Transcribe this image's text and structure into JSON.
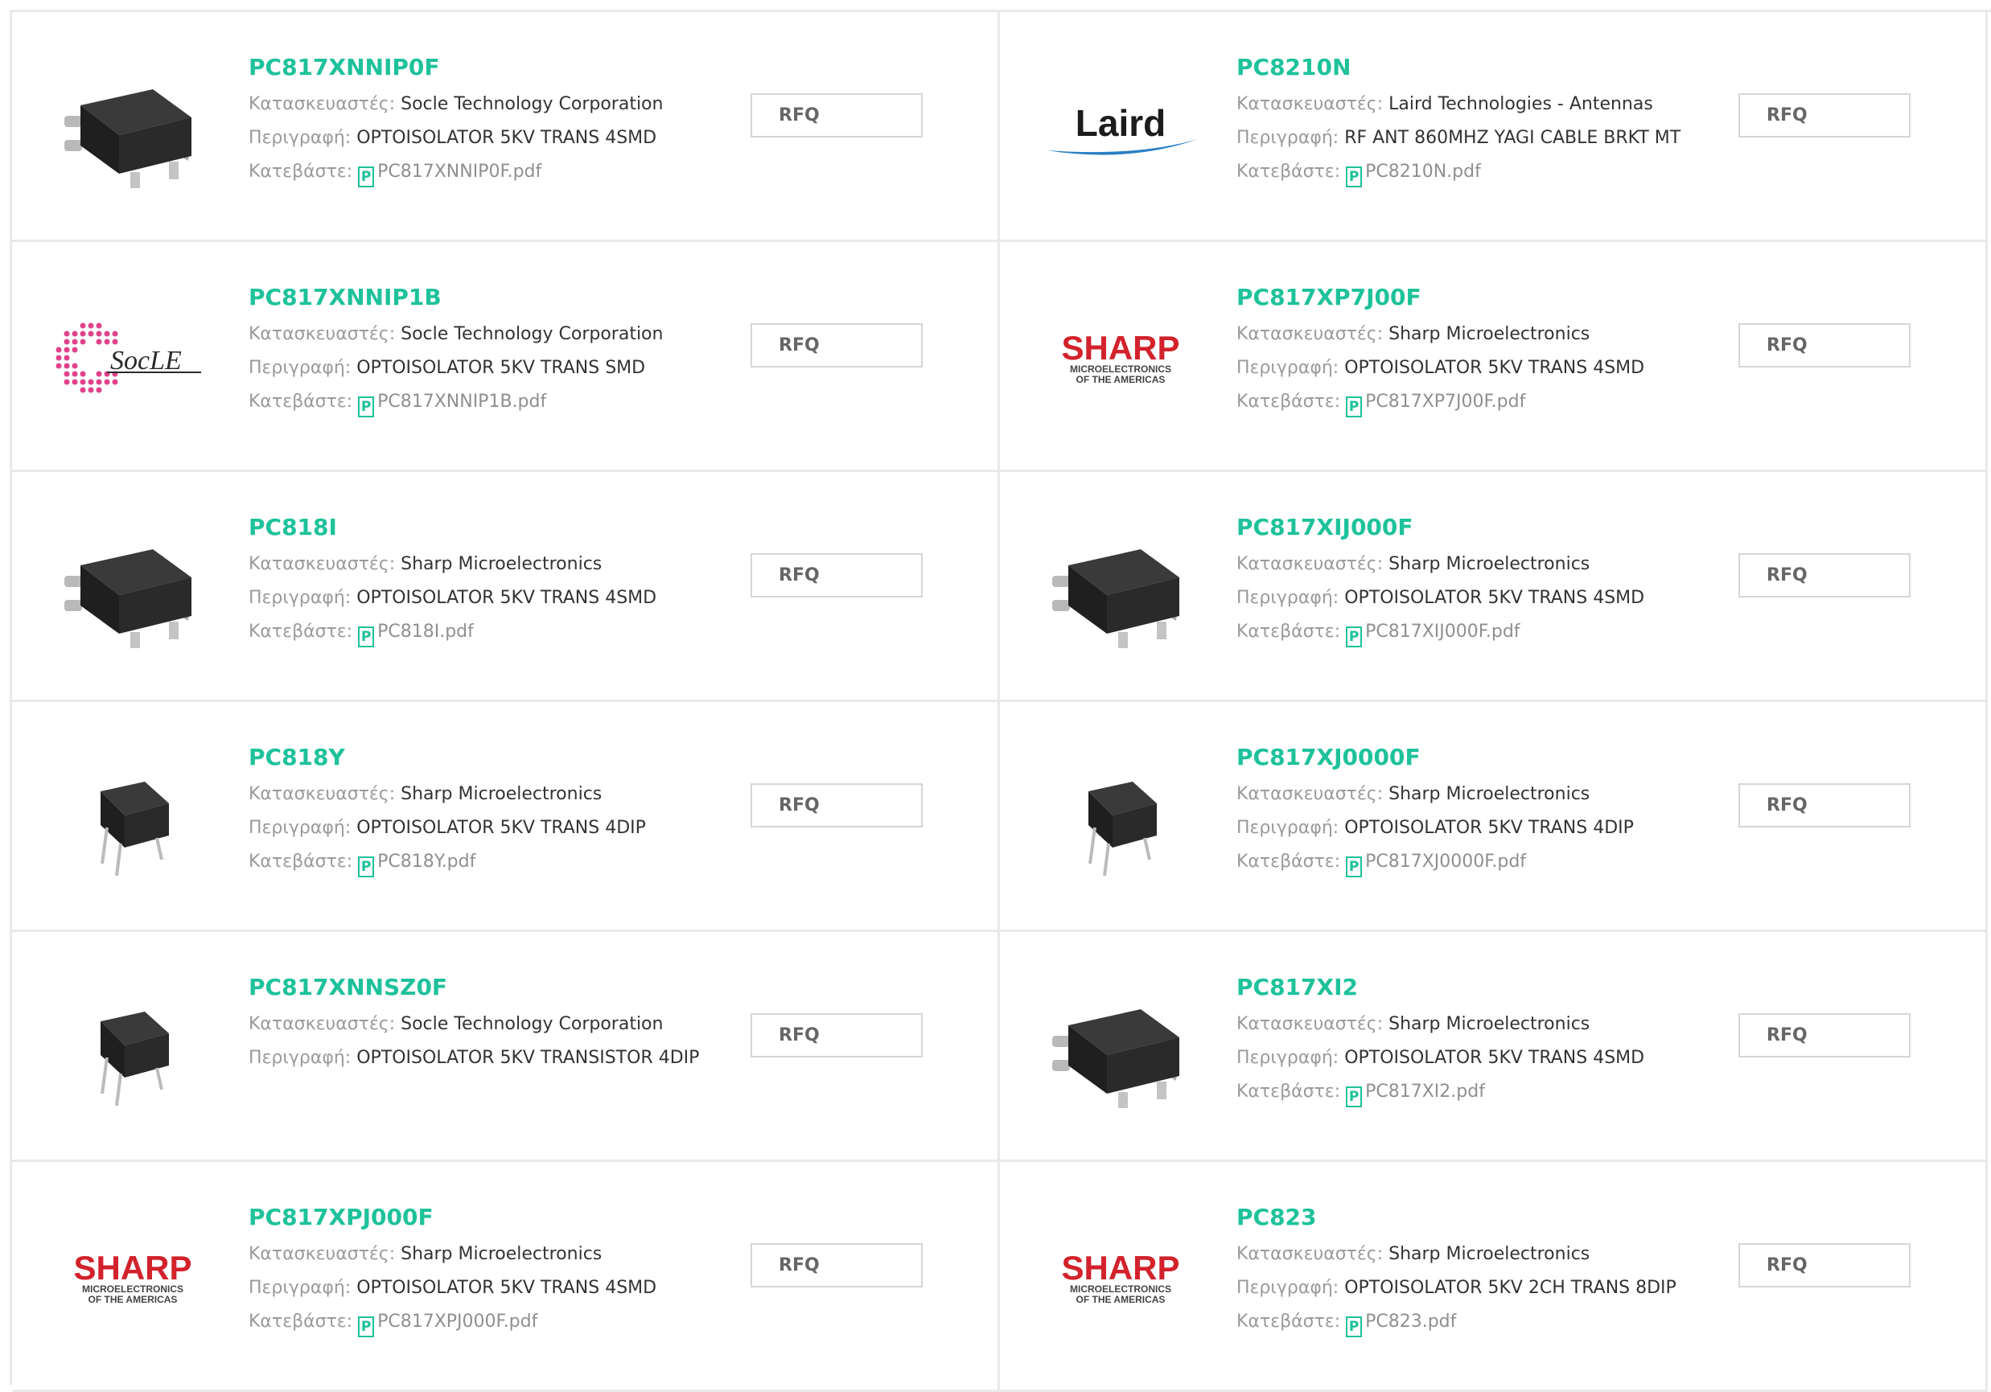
{
  "labels": {
    "manufacturer": "Κατασκευαστές: ",
    "description": "Περιγραφή: ",
    "download": "Κατεβάστε: ",
    "rfq": "RFQ"
  },
  "colors": {
    "accent": "#1ec29a",
    "sharp_red": "#d2222c",
    "laird_blue": "#2a7fc4",
    "socle_pink": "#e0418a"
  },
  "products": [
    {
      "part": "PC817XNNIP0F",
      "manufacturer": "Socle Technology Corporation",
      "description": "OPTOISOLATOR 5KV TRANS 4SMD",
      "download": "PC817XNNIP0F.pdf",
      "image": "smd-chip-icon"
    },
    {
      "part": "PC8210N",
      "manufacturer": "Laird Technologies - Antennas",
      "description": "RF ANT 860MHZ YAGI CABLE BRKT MT",
      "download": "PC8210N.pdf",
      "image": "laird-logo",
      "logo_text": "Laird"
    },
    {
      "part": "PC817XNNIP1B",
      "manufacturer": "Socle Technology Corporation",
      "description": "OPTOISOLATOR 5KV TRANS SMD",
      "download": "PC817XNNIP1B.pdf",
      "image": "socle-logo",
      "logo_text": "SocLE"
    },
    {
      "part": "PC817XP7J00F",
      "manufacturer": "Sharp Microelectronics",
      "description": "OPTOISOLATOR 5KV TRANS 4SMD",
      "download": "PC817XP7J00F.pdf",
      "image": "sharp-logo",
      "logo_text": "SHARP",
      "logo_sub1": "MICROELECTRONICS",
      "logo_sub2": "OF THE AMERICAS"
    },
    {
      "part": "PC818I",
      "manufacturer": "Sharp Microelectronics",
      "description": "OPTOISOLATOR 5KV TRANS 4SMD",
      "download": "PC818I.pdf",
      "image": "smd-chip-icon"
    },
    {
      "part": "PC817XIJ000F",
      "manufacturer": "Sharp Microelectronics",
      "description": "OPTOISOLATOR 5KV TRANS 4SMD",
      "download": "PC817XIJ000F.pdf",
      "image": "smd-chip-icon"
    },
    {
      "part": "PC818Y",
      "manufacturer": "Sharp Microelectronics",
      "description": "OPTOISOLATOR 5KV TRANS 4DIP",
      "download": "PC818Y.pdf",
      "image": "dip-chip-icon"
    },
    {
      "part": "PC817XJ0000F",
      "manufacturer": "Sharp Microelectronics",
      "description": "OPTOISOLATOR 5KV TRANS 4DIP",
      "download": "PC817XJ0000F.pdf",
      "image": "dip-chip-icon"
    },
    {
      "part": "PC817XNNSZ0F",
      "manufacturer": "Socle Technology Corporation",
      "description": "OPTOISOLATOR 5KV TRANSISTOR 4DIP",
      "download": "",
      "image": "dip-chip-icon"
    },
    {
      "part": "PC817XI2",
      "manufacturer": "Sharp Microelectronics",
      "description": "OPTOISOLATOR 5KV TRANS 4SMD",
      "download": "PC817XI2.pdf",
      "image": "smd-chip-icon"
    },
    {
      "part": "PC817XPJ000F",
      "manufacturer": "Sharp Microelectronics",
      "description": "OPTOISOLATOR 5KV TRANS 4SMD",
      "download": "PC817XPJ000F.pdf",
      "image": "sharp-logo",
      "logo_text": "SHARP",
      "logo_sub1": "MICROELECTRONICS",
      "logo_sub2": "OF THE AMERICAS"
    },
    {
      "part": "PC823",
      "manufacturer": "Sharp Microelectronics",
      "description": "OPTOISOLATOR 5KV 2CH TRANS 8DIP",
      "download": "PC823.pdf",
      "image": "sharp-logo",
      "logo_text": "SHARP",
      "logo_sub1": "MICROELECTRONICS",
      "logo_sub2": "OF THE AMERICAS"
    }
  ]
}
